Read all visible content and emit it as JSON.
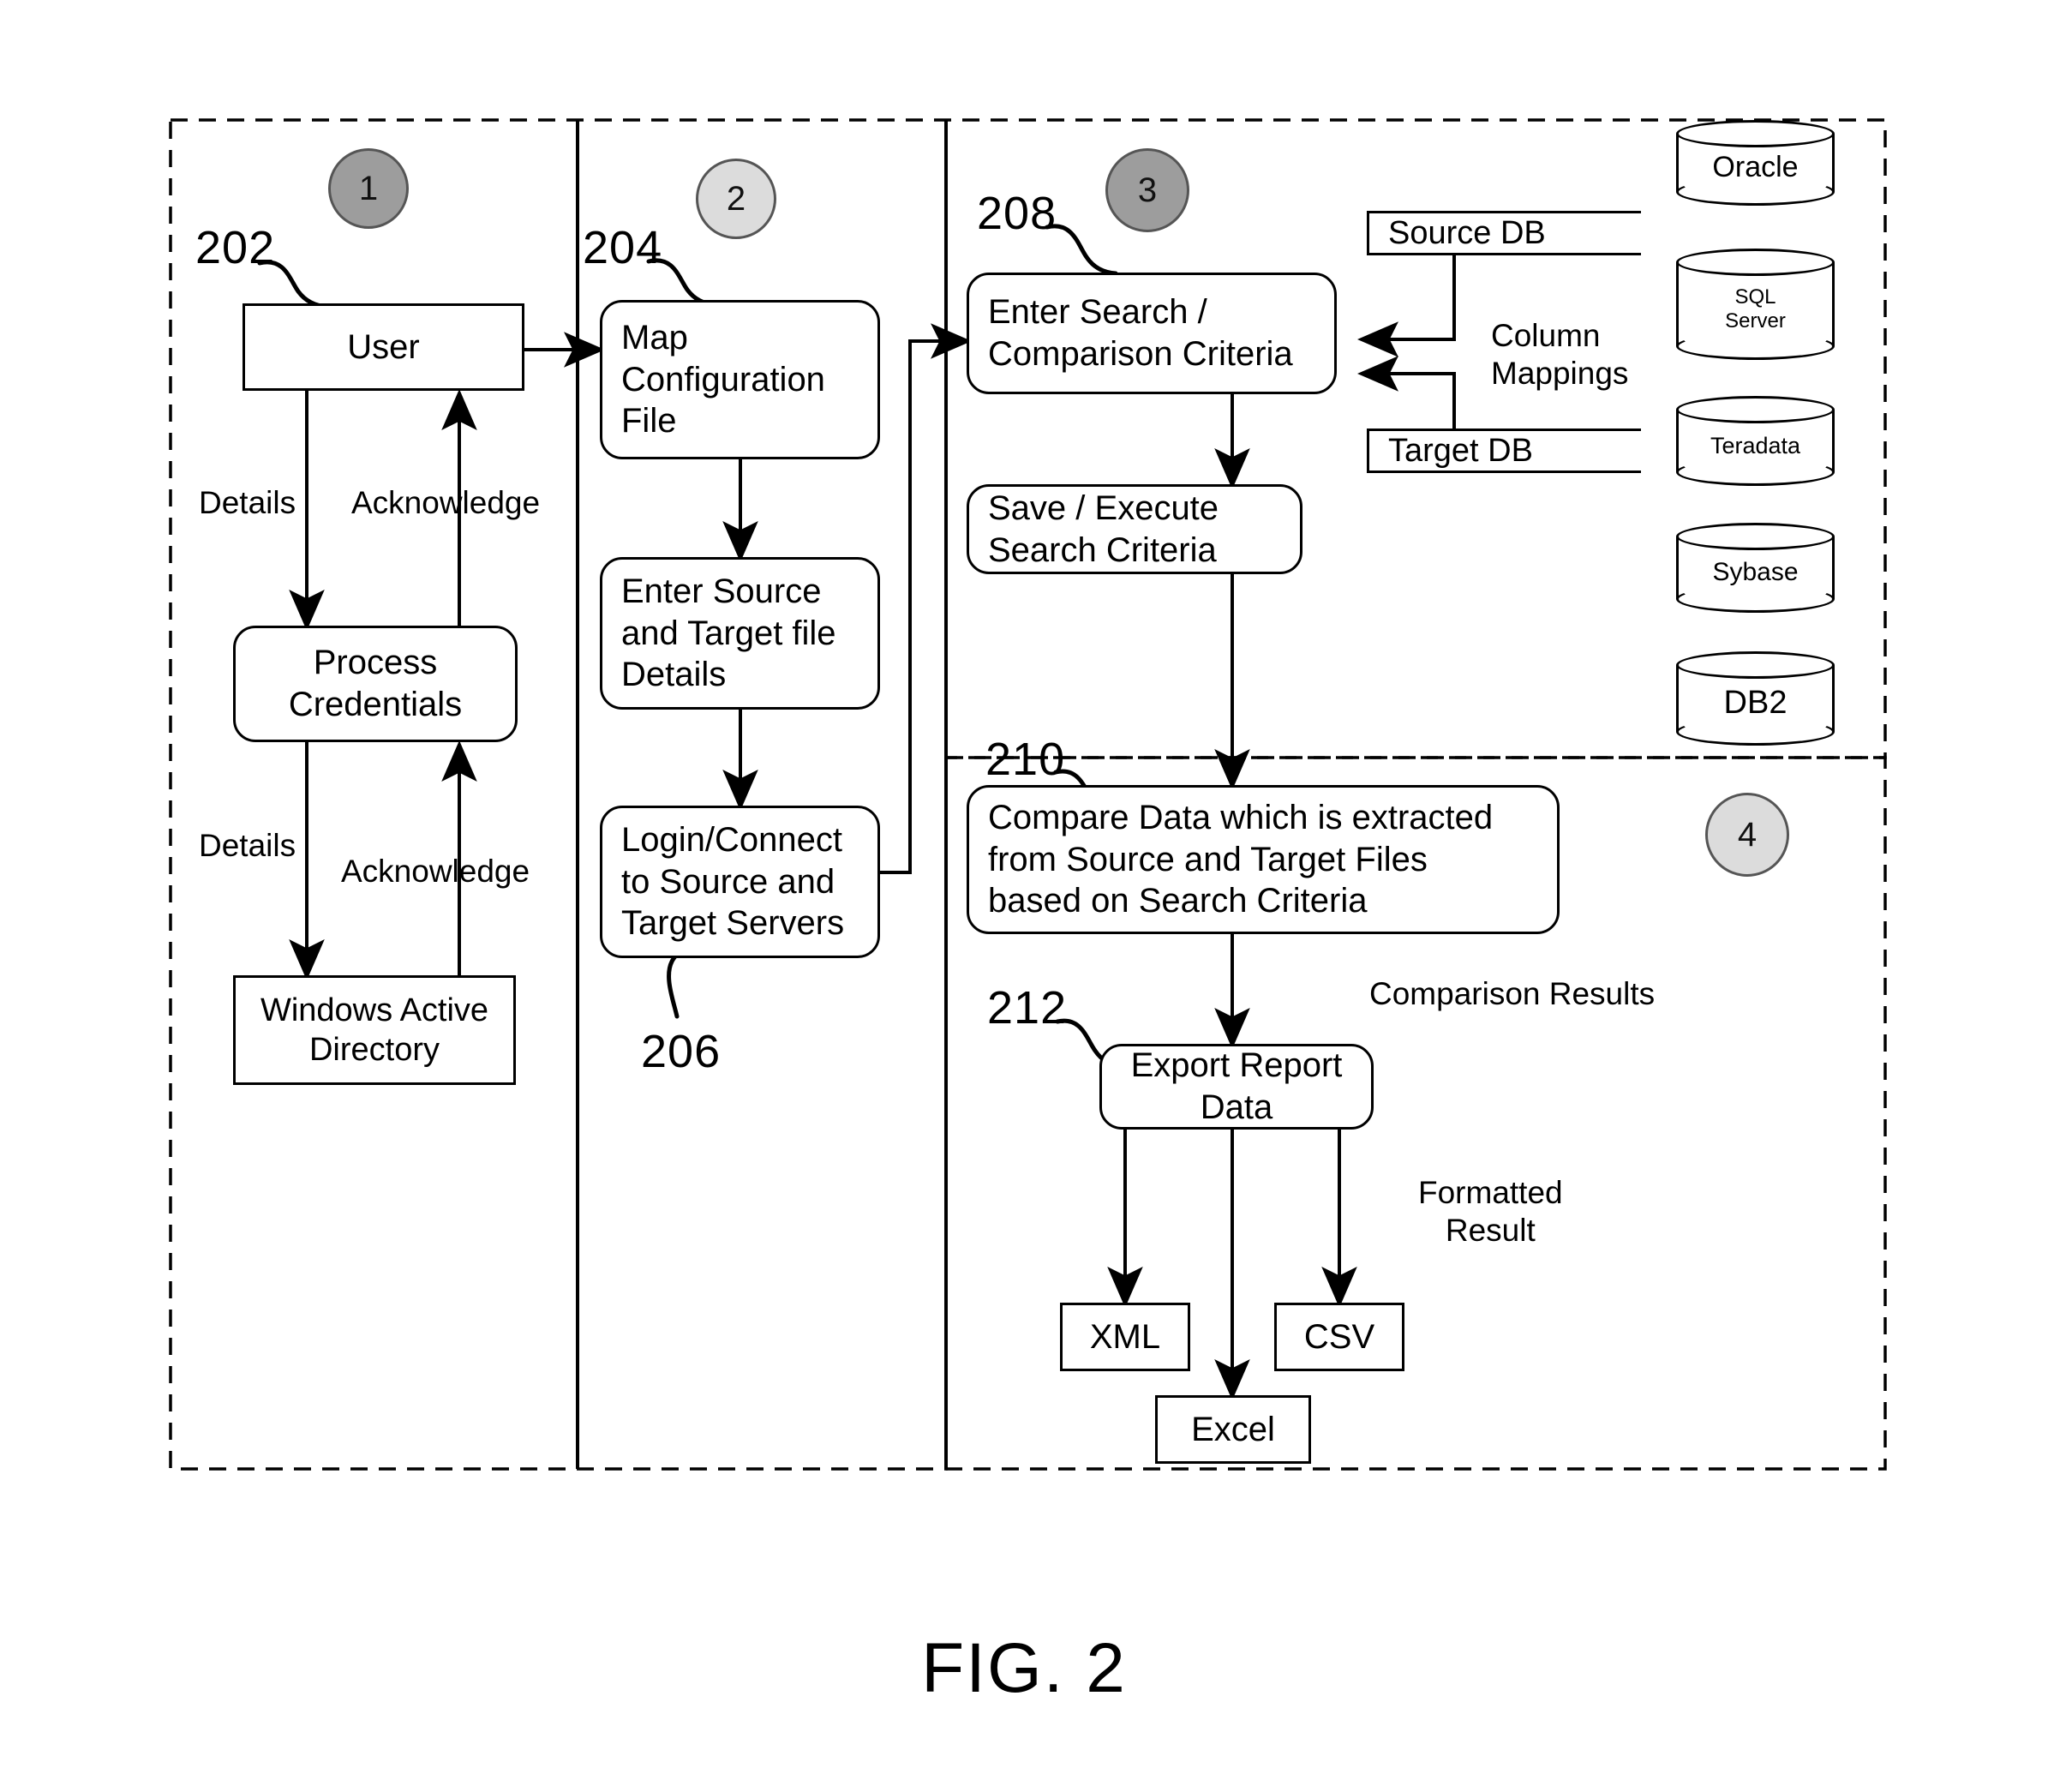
{
  "figure": {
    "caption": "FIG. 2"
  },
  "lanes": [
    {
      "id": "lane-1",
      "badge": "1"
    },
    {
      "id": "lane-2",
      "badge": "2"
    },
    {
      "id": "lane-3",
      "badge": "3"
    },
    {
      "id": "lane-4",
      "badge": "4"
    }
  ],
  "reference_numerals": {
    "n202": "202",
    "n204": "204",
    "n206": "206",
    "n208": "208",
    "n210": "210",
    "n212": "212"
  },
  "lane1": {
    "user": "User",
    "process_credentials": "Process\nCredentials",
    "windows_active_directory": "Windows Active\nDirectory",
    "details_top": "Details",
    "acknowledge_top": "Acknowledge",
    "details_bottom": "Details",
    "acknowledge_bottom": "Acknowledge"
  },
  "lane2": {
    "map_configuration_file": "Map\nConfiguration\nFile",
    "enter_source_target_file_details": "Enter Source\nand Target file\nDetails",
    "login_connect": "Login/Connect\nto Source and\nTarget Servers"
  },
  "lane3": {
    "enter_search_criteria": "Enter Search /\nComparison Criteria",
    "save_execute": "Save / Execute\nSearch Criteria",
    "source_db": "Source DB",
    "target_db": "Target DB",
    "column_mappings": "Column\nMappings"
  },
  "lane4": {
    "compare_data": "Compare Data which  is  extracted\nfrom Source and Target  Files\nbased on Search  Criteria",
    "export_report_data": "Export Report\nData",
    "comparison_results": "Comparison Results",
    "formatted_result": "Formatted\nResult",
    "outputs": [
      {
        "label": "XML"
      },
      {
        "label": "Excel"
      },
      {
        "label": "CSV"
      }
    ]
  },
  "databases": [
    {
      "label": "Oracle",
      "size": "large"
    },
    {
      "label": "SQL\nServer",
      "size": "small"
    },
    {
      "label": "Teradata",
      "size": "small"
    },
    {
      "label": "Sybase",
      "size": "small"
    },
    {
      "label": "DB2",
      "size": "large"
    }
  ],
  "colors": {
    "stroke": "#000000",
    "bubble_dark": "#9d9d9d",
    "bubble_light": "#dcdcdc",
    "background": "#ffffff"
  }
}
